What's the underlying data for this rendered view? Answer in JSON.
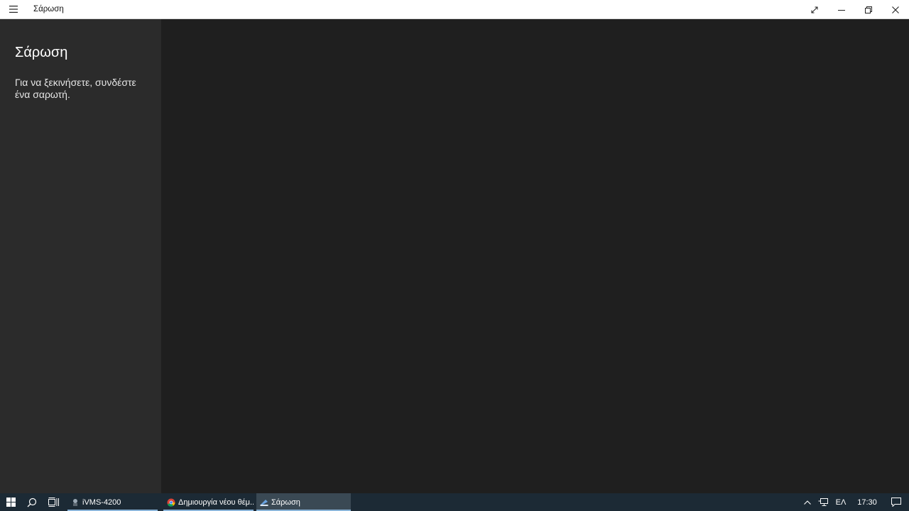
{
  "window": {
    "title": "Σάρωση"
  },
  "sidebar": {
    "heading": "Σάρωση",
    "message": "Για να ξεκινήσετε, συνδέστε ένα σαρωτή."
  },
  "taskbar": {
    "tasks": [
      {
        "label": "iVMS-4200",
        "icon": "ivms-app-icon"
      },
      {
        "label": "Δημιουργία νέου θέμ...",
        "icon": "chrome-icon"
      },
      {
        "label": "Σάρωση",
        "icon": "scan-app-icon"
      }
    ],
    "tray": {
      "language": "ΕΛ",
      "time": "17:30"
    }
  },
  "colors": {
    "sidebar_bg": "#2b2b2b",
    "main_bg": "#1f1f1f",
    "taskbar_bg": "#1c2a35",
    "task_underline": "#8ab4d8"
  }
}
